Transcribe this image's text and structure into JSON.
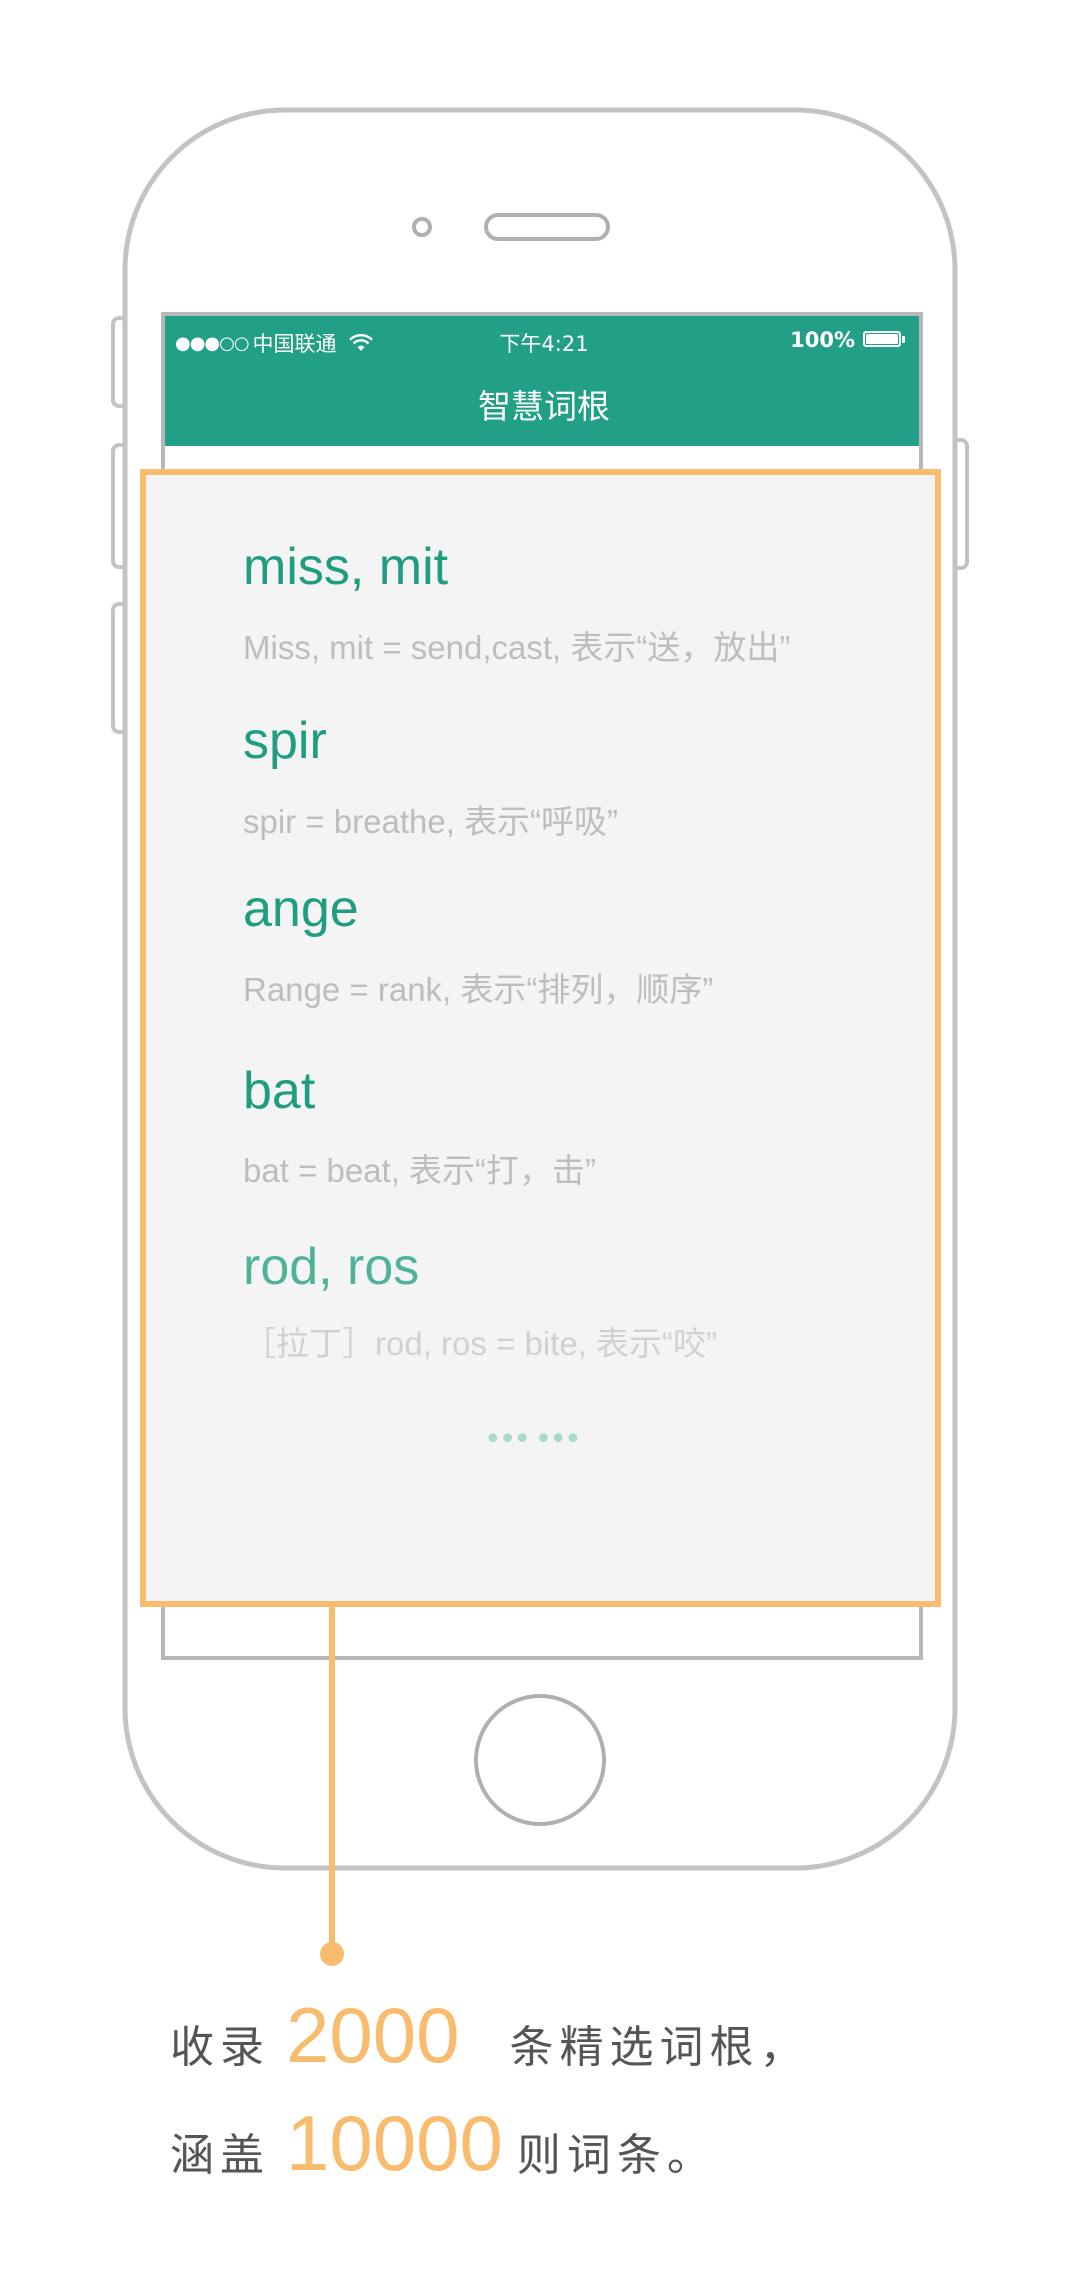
{
  "status_bar": {
    "carrier": "中国联通",
    "signal": "●●●○○",
    "time": "下午4:21",
    "battery": "100%"
  },
  "nav": {
    "title": "智慧词根"
  },
  "entries": [
    {
      "word": "miss, mit",
      "definition": "Miss, mit = send,cast, 表示“送，放出”"
    },
    {
      "word": "spir",
      "definition": "spir = breathe, 表示“呼吸”"
    },
    {
      "word": "ange",
      "definition": "Range = rank, 表示“排列，顺序”"
    },
    {
      "word": "bat",
      "definition": "bat = beat, 表示“打，击”"
    },
    {
      "word": "rod, ros",
      "definition": "［拉丁］rod, ros = bite, 表示“咬”"
    }
  ],
  "more_indicator": "••• •••",
  "caption": {
    "line1_prefix": "收录",
    "line1_number": "2000",
    "line1_suffix": "条精选词根，",
    "line2_prefix": "涵盖",
    "line2_number": "10000",
    "line2_suffix": "则词条。"
  },
  "colors": {
    "accent_green": "#21a087",
    "highlight_orange": "#f8bc6e",
    "phone_outline": "#bdbdbd",
    "content_bg": "#f4f4f4"
  }
}
